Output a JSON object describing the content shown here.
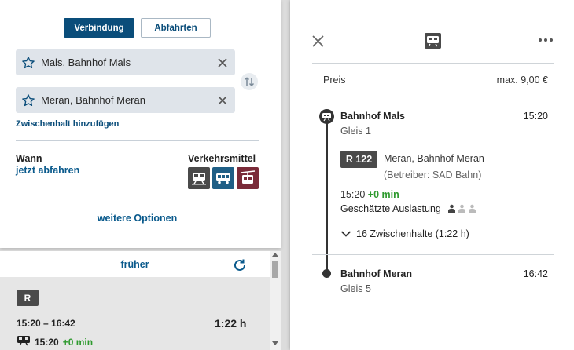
{
  "search": {
    "tabs": [
      {
        "label": "Verbindung",
        "active": true
      },
      {
        "label": "Abfahrten",
        "active": false
      }
    ],
    "from": "Mals, Bahnhof Mals",
    "to": "Meran, Bahnhof Meran",
    "add_via": "Zwischenhalt hinzufügen",
    "when_label": "Wann",
    "when_value": "jetzt abfahren",
    "modes_label": "Verkehrsmittel",
    "modes": [
      {
        "icon": "train-icon",
        "color": "#4a4a4a"
      },
      {
        "icon": "bus-icon",
        "color": "#1f5f86"
      },
      {
        "icon": "cable-car-icon",
        "color": "#7a2a38"
      }
    ],
    "more_options": "weitere Optionen"
  },
  "results": {
    "earlier": "früher",
    "connection": {
      "badge": "R",
      "times": "15:20 – 16:42",
      "duration": "1:22 h",
      "departure": "15:20",
      "delay": "+0 min"
    }
  },
  "detail": {
    "price_label": "Preis",
    "price_value": "max. 9,00 €",
    "origin": {
      "name": "Bahnhof Mals",
      "time": "15:20",
      "platform": "Gleis 1"
    },
    "line": "R 122",
    "direction": "Meran, Bahnhof Meran",
    "operator": "(Betreiber: SAD Bahn)",
    "dep_time": "15:20",
    "dep_delay": "+0 min",
    "load_label": "Geschätzte Auslastung",
    "load_level": "1 of 3",
    "intermediate": "16 Zwischenhalte (1:22 h)",
    "destination": {
      "name": "Bahnhof Meran",
      "time": "16:42",
      "platform": "Gleis 5"
    }
  },
  "colors": {
    "primary": "#0a4d7a",
    "link": "#0a5a8c",
    "on_time": "#2e9a2e"
  }
}
